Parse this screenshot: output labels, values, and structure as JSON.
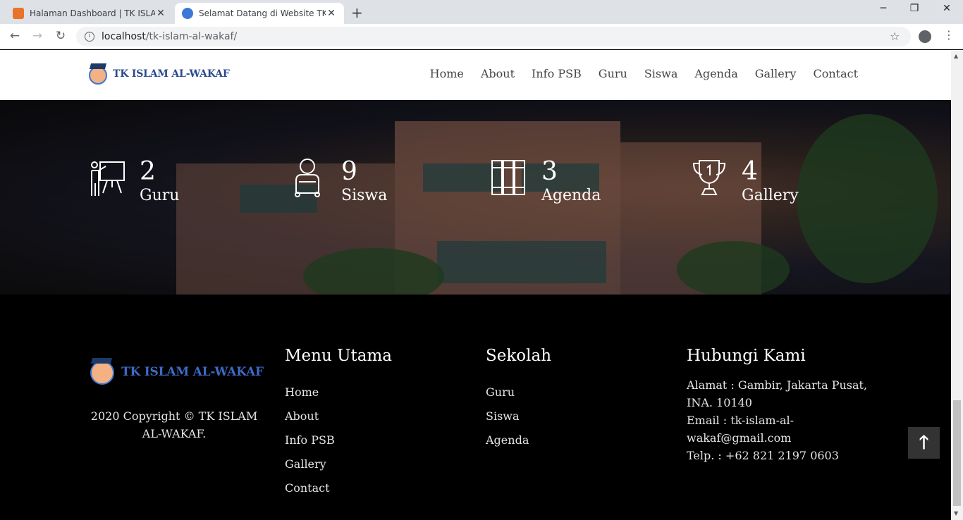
{
  "browser": {
    "tabs": [
      {
        "title": "Halaman Dashboard | TK ISLAM AL-WAKAF",
        "active": false,
        "favicon_color": "#e8732a"
      },
      {
        "title": "Selamat Datang di Website TK ISLAM AL-WAKAF",
        "active": true,
        "favicon_color": "#3c78d8"
      }
    ],
    "new_tab": "+",
    "window_controls": {
      "minimize": "─",
      "maximize": "❐",
      "close": "✕"
    },
    "nav": {
      "back": "←",
      "forward": "→",
      "reload": "↻"
    },
    "url_host": "localhost",
    "url_path": "/tk-islam-al-wakaf/",
    "star": "☆",
    "menu": "⋮"
  },
  "site": {
    "brand": "TK ISLAM AL-WAKAF",
    "menu": [
      "Home",
      "About",
      "Info PSB",
      "Guru",
      "Siswa",
      "Agenda",
      "Gallery",
      "Contact"
    ]
  },
  "stats": [
    {
      "icon": "teacher-board-icon",
      "value": "2",
      "label": "Guru"
    },
    {
      "icon": "student-icon",
      "value": "9",
      "label": "Siswa"
    },
    {
      "icon": "books-icon",
      "value": "3",
      "label": "Agenda"
    },
    {
      "icon": "trophy-icon",
      "value": "4",
      "label": "Gallery"
    }
  ],
  "footer": {
    "brand": "TK ISLAM AL-WAKAF",
    "copyright_line1": "2020 Copyright © TK ISLAM",
    "copyright_line2": "AL-WAKAF.",
    "menu_utama": {
      "title": "Menu Utama",
      "items": [
        "Home",
        "About",
        "Info PSB",
        "Gallery",
        "Contact"
      ]
    },
    "sekolah": {
      "title": "Sekolah",
      "items": [
        "Guru",
        "Siswa",
        "Agenda"
      ]
    },
    "hubungi": {
      "title": "Hubungi Kami",
      "lines": [
        "Alamat : Gambir, Jakarta Pusat,",
        "INA. 10140",
        "Email : tk-islam-al-",
        "wakaf@gmail.com",
        "Telp. : +62 821 2197 0603"
      ]
    },
    "back_to_top": "🡑"
  }
}
